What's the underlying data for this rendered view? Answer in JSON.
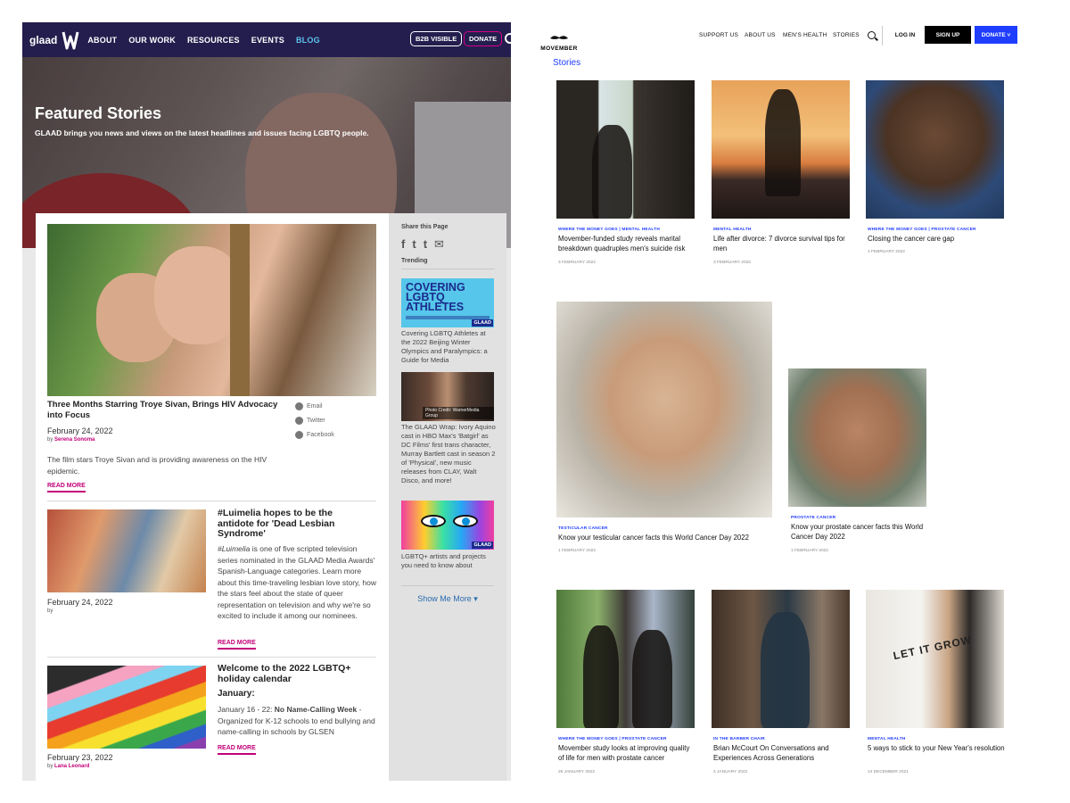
{
  "glaad": {
    "logo_text": "glaad",
    "nav": [
      "ABOUT",
      "OUR WORK",
      "RESOURCES",
      "EVENTS",
      "BLOG"
    ],
    "b2b_label": "B2B VISIBLE",
    "donate_label": "DONATE",
    "hero": {
      "title": "Featured Stories",
      "subtitle": "GLAAD brings you news and views on the latest headlines and issues facing LGBTQ people."
    },
    "featured": {
      "title": "Three Months Starring Troye Sivan, Brings HIV Advocacy into Focus",
      "date": "February 24, 2022",
      "by": "by",
      "author": "Serena Sonoma",
      "excerpt": "The film stars Troye Sivan and is providing awareness on the HIV epidemic.",
      "read_more": "READ MORE",
      "share": [
        "Email",
        "Twitter",
        "Facebook"
      ]
    },
    "articles": [
      {
        "title": "#Luimelia hopes to be the antidote for 'Dead Lesbian Syndrome'",
        "excerpt_em": "#Luimelia",
        "excerpt": " is one of five scripted television series nominated in the GLAAD Media Awards' Spanish-Language categories. Learn more about this time-traveling lesbian love story, how the stars feel about the state of queer representation on television and why we're so excited to include it among our nominees.",
        "date": "February 24, 2022",
        "by": "by",
        "read_more": "READ MORE"
      },
      {
        "title": "Welcome to the 2022 LGBTQ+ holiday calendar",
        "subhead": "January:",
        "excerpt_bold": "No Name-Calling Week",
        "excerpt_pre": "January 16 - 22: ",
        "excerpt": " - Organized for K-12 schools to end bullying and name-calling in schools by GLSEN",
        "date": "February 23, 2022",
        "by": "by",
        "author": "Lana Leonard",
        "read_more": "READ MORE"
      }
    ],
    "sidebar": {
      "share_heading": "Share this Page",
      "social": [
        "f",
        "t",
        "t",
        "✉"
      ],
      "trending_heading": "Trending",
      "trending": [
        {
          "image_text": "COVERING LGBTQ ATHLETES",
          "logo": "GLAAD",
          "caption": "Covering LGBTQ Athletes at the 2022 Beijing Winter Olympics and Paralympics: a Guide for Media"
        },
        {
          "image_credit": "Photo Credit: WarnerMedia Group",
          "caption": "The GLAAD Wrap: Ivory Aquino cast in HBO Max's 'Batgirl' as DC Films' first trans character, Murray Bartlett cast in season 2 of 'Physical', new music releases from CLAY, Walt Disco, and more!"
        },
        {
          "logo": "GLAAD",
          "caption": "LGBTQ+ artists and projects you need to know about"
        }
      ],
      "show_more": "Show Me More ▾"
    }
  },
  "movember": {
    "logo_text": "MOVEMBER",
    "menu": [
      "SUPPORT US",
      "ABOUT US",
      "MEN'S HEALTH",
      "STORIES"
    ],
    "login": "LOG IN",
    "signup": "SIGN UP",
    "donate": "DONATE ˅",
    "section_title": "Stories",
    "cards": [
      {
        "category": "WHERE THE MONEY GOES | MENTAL HEALTH",
        "title": "Movember-funded study reveals marital breakdown quadruples men's suicide risk",
        "date": "3 FEBRUARY 2022"
      },
      {
        "category": "MENTAL HEALTH",
        "title": "Life after divorce: 7 divorce survival tips for men",
        "date": "3 FEBRUARY 2022"
      },
      {
        "category": "WHERE THE MONEY GOES | PROSTATE CANCER",
        "title": "Closing the cancer care gap",
        "date": "1 FEBRUARY 2022"
      },
      {
        "category": "TESTICULAR CANCER",
        "title": "Know your testicular cancer facts this World Cancer Day 2022",
        "date": "1 FEBRUARY 2022"
      },
      {
        "category": "PROSTATE CANCER",
        "title": "Know your prostate cancer facts this World Cancer Day 2022",
        "date": "1 FEBRUARY 2022"
      },
      {
        "category": "WHERE THE MONEY GOES | PROSTATE CANCER",
        "title": "Movember study looks at improving quality of life for men with prostate cancer",
        "date": "26 JANUARY 2022"
      },
      {
        "category": "IN THE BARBER CHAIR",
        "title": "Brian McCourt On Conversations and Experiences Across Generations",
        "date": "4 JANUARY 2022"
      },
      {
        "category": "MENTAL HEALTH",
        "title": "5 ways to stick to your New Year's resolution",
        "date": "14 DECEMBER 2021"
      }
    ],
    "shirt_text": "LET IT GROW"
  }
}
